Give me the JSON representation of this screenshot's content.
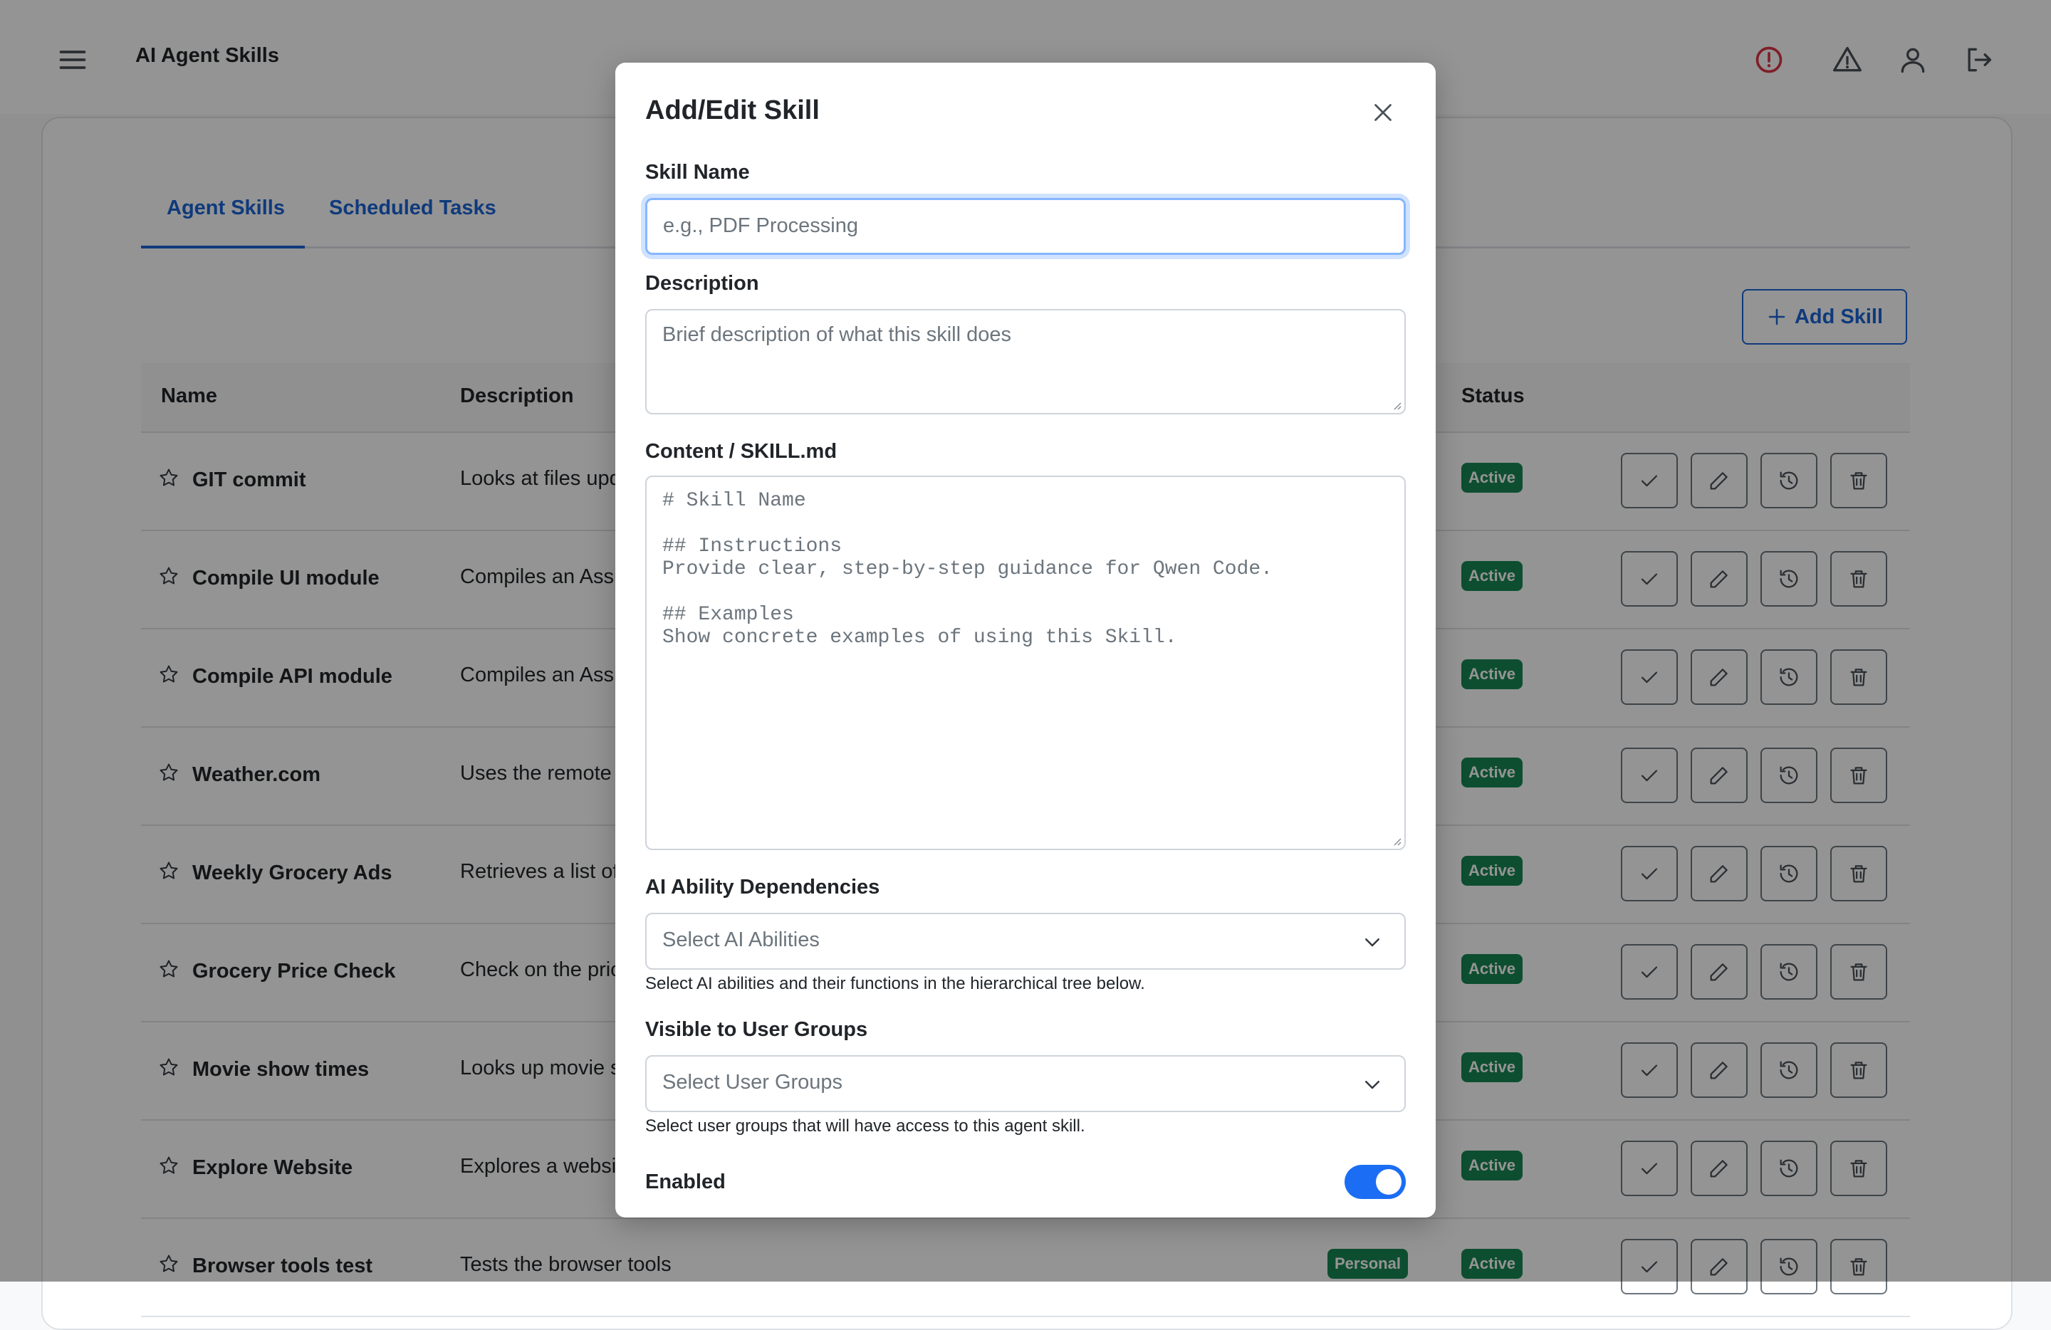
{
  "app": {
    "title": "AI Agent Skills",
    "icons": [
      "menu-icon",
      "error-alert-icon",
      "warning-icon",
      "user-icon",
      "logout-icon"
    ],
    "colors": {
      "accent": "#1b65d6",
      "success": "#198754",
      "error": "#dc3545"
    }
  },
  "tabs": [
    "Agent Skills",
    "Scheduled Tasks"
  ],
  "active_tab": "Agent Skills",
  "add_skill_label": "Add Skill",
  "table": {
    "headers": {
      "name": "Name",
      "description": "Description",
      "status": "Status"
    },
    "rows": [
      {
        "name": "GIT commit",
        "description": "Looks at files upd",
        "status": "Active"
      },
      {
        "name": "Compile UI module",
        "description": "Compiles an Assi",
        "status": "Active"
      },
      {
        "name": "Compile API module",
        "description": "Compiles an Assi",
        "status": "Active"
      },
      {
        "name": "Weather.com",
        "description": "Uses the remote I",
        "status": "Active"
      },
      {
        "name": "Weekly Grocery Ads",
        "description": "Retrieves a list of",
        "status": "Active"
      },
      {
        "name": "Grocery Price Check",
        "description": "Check on the pric",
        "status": "Active"
      },
      {
        "name": "Movie show times",
        "description": "Looks up movie s",
        "status": "Active"
      },
      {
        "name": "Explore Website",
        "description": "Explores a websit",
        "status": "Active"
      },
      {
        "name": "Browser tools test",
        "description": "Tests the browser tools",
        "type": "Personal",
        "status": "Active"
      }
    ],
    "action_icons": [
      "check-icon",
      "pencil-icon",
      "history-icon",
      "trash-icon"
    ]
  },
  "modal": {
    "title": "Add/Edit Skill",
    "skill_name": {
      "label": "Skill Name",
      "value": "",
      "placeholder": "e.g., PDF Processing"
    },
    "description": {
      "label": "Description",
      "value": "",
      "placeholder": "Brief description of what this skill does"
    },
    "content": {
      "label": "Content / SKILL.md",
      "value": "",
      "placeholder": "# Skill Name\n\n## Instructions\nProvide clear, step-by-step guidance for Qwen Code.\n\n## Examples\nShow concrete examples of using this Skill."
    },
    "ai_abilities": {
      "label": "AI Ability Dependencies",
      "placeholder": "Select AI Abilities",
      "help": "Select AI abilities and their functions in the hierarchical tree below."
    },
    "user_groups": {
      "label": "Visible to User Groups",
      "placeholder": "Select User Groups",
      "help": "Select user groups that will have access to this agent skill."
    },
    "enabled": {
      "label": "Enabled",
      "value": true
    }
  }
}
